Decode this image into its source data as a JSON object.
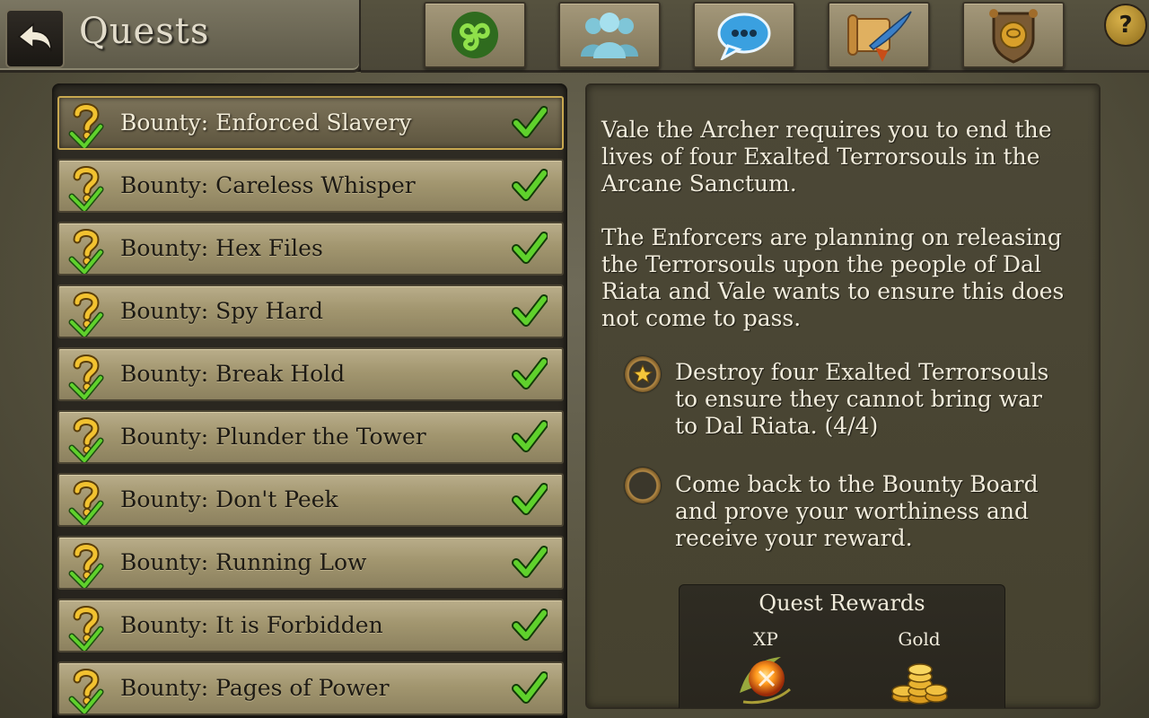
{
  "header": {
    "title": "Quests",
    "nav": [
      {
        "name": "triskele-icon"
      },
      {
        "name": "party-icon"
      },
      {
        "name": "chat-icon"
      },
      {
        "name": "scroll-quill-icon"
      },
      {
        "name": "guild-shield-icon"
      }
    ],
    "help_label": "?"
  },
  "quests": [
    {
      "label": "Bounty: Enforced Slavery",
      "selected": true,
      "completed": true
    },
    {
      "label": "Bounty: Careless Whisper",
      "completed": true
    },
    {
      "label": "Bounty: Hex Files",
      "completed": true
    },
    {
      "label": "Bounty: Spy Hard",
      "completed": true
    },
    {
      "label": "Bounty: Break Hold",
      "completed": true
    },
    {
      "label": "Bounty: Plunder the Tower",
      "completed": true
    },
    {
      "label": "Bounty: Don't Peek",
      "completed": true
    },
    {
      "label": "Bounty: Running Low",
      "completed": true
    },
    {
      "label": "Bounty: It is Forbidden",
      "completed": true
    },
    {
      "label": "Bounty: Pages of Power",
      "completed": true
    }
  ],
  "detail": {
    "paragraph1": "Vale the Archer requires you to end the lives of four Exalted Terrorsouls in the Arcane Sanctum.",
    "paragraph2": "The Enforcers are planning on releasing the Terrorsouls upon the people of Dal Riata and Vale wants to ensure this does not come to pass.",
    "objectives": [
      {
        "text": "Destroy four Exalted Terrorsouls to ensure they cannot bring war to Dal Riata. (4/4)",
        "status": "complete"
      },
      {
        "text": "Come back to the Bounty Board and prove your worthiness and receive your reward.",
        "status": "pending"
      }
    ],
    "rewards": {
      "title": "Quest Rewards",
      "xp_label": "XP",
      "gold_label": "Gold"
    }
  },
  "colors": {
    "selected_border": "#c8a850",
    "check_green": "#4caf2a",
    "text_light": "#f1ecdc"
  }
}
